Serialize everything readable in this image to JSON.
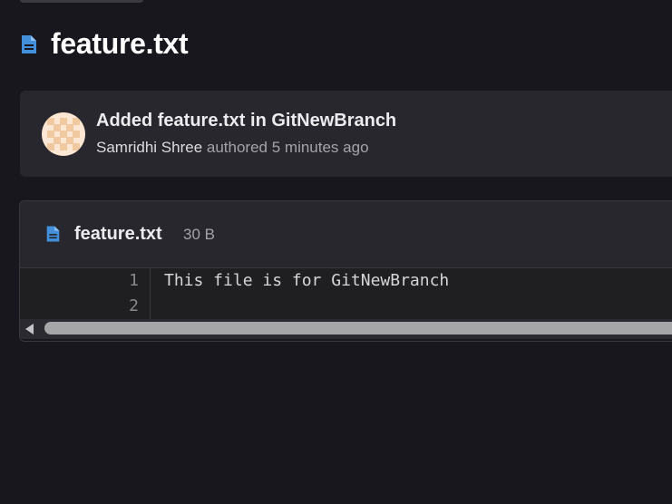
{
  "page": {
    "title": "feature.txt",
    "title_icon": "file-text-icon"
  },
  "commit": {
    "title": "Added feature.txt in GitNewBranch",
    "author": "Samridhi Shree",
    "authored_text": " authored 5 minutes ago",
    "avatar_icon": "identicon-avatar"
  },
  "file": {
    "icon": "file-text-icon",
    "name": "feature.txt",
    "size": "30 B",
    "lines": [
      {
        "number": "1",
        "text": "This file is for GitNewBranch"
      },
      {
        "number": "2",
        "text": ""
      }
    ]
  },
  "colors": {
    "background": "#18171d",
    "card": "#28272d",
    "accent_icon": "#428fdc",
    "avatar_bg": "#fbe7d4",
    "avatar_pattern": "#f1c9a0"
  }
}
